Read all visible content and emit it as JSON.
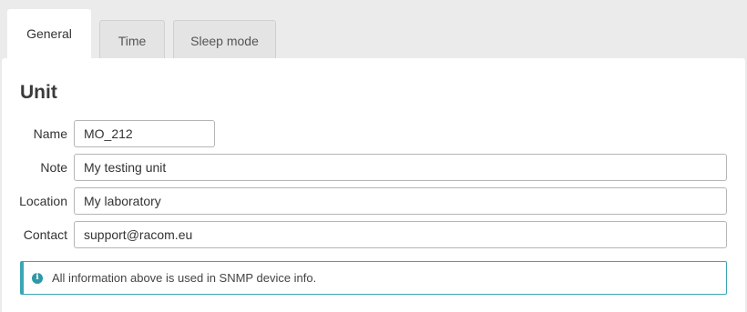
{
  "tabs": [
    {
      "label": "General",
      "active": true
    },
    {
      "label": "Time",
      "active": false
    },
    {
      "label": "Sleep mode",
      "active": false
    }
  ],
  "section": {
    "title": "Unit"
  },
  "form": {
    "name": {
      "label": "Name",
      "value": "MO_212"
    },
    "note": {
      "label": "Note",
      "value": "My testing unit"
    },
    "location": {
      "label": "Location",
      "value": "My laboratory"
    },
    "contact": {
      "label": "Contact",
      "value": "support@racom.eu"
    }
  },
  "info": {
    "icon": "info-circle-icon",
    "text": "All information above is used in SNMP device info.",
    "accent_color": "#3aa6b4"
  }
}
